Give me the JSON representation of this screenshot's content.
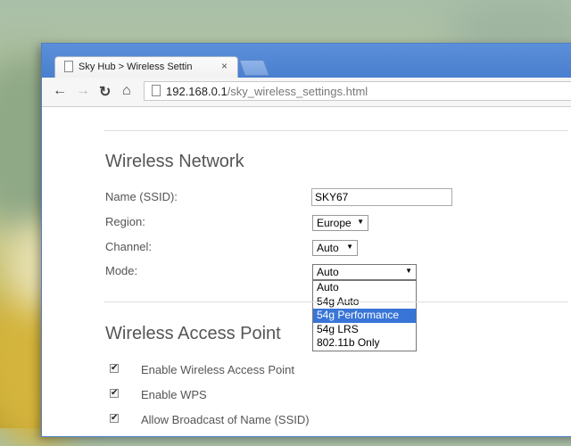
{
  "browser": {
    "tab_title": "Sky Hub > Wireless Settin",
    "tab_close": "×",
    "url_host": "192.168.0.1",
    "url_path": "/sky_wireless_settings.html"
  },
  "wireless_network": {
    "heading": "Wireless Network",
    "name_label": "Name (SSID):",
    "name_value": "SKY67",
    "region_label": "Region:",
    "region_value": "Europe",
    "channel_label": "Channel:",
    "channel_value": "Auto",
    "mode_label": "Mode:",
    "mode_value": "Auto",
    "mode_options": [
      "Auto",
      "54g Auto",
      "54g Performance",
      "54g LRS",
      "802.11b Only"
    ],
    "mode_highlighted": "54g Performance"
  },
  "wireless_access_point": {
    "heading": "Wireless Access Point",
    "checkboxes": [
      {
        "label": "Enable Wireless Access Point",
        "checked": true
      },
      {
        "label": "Enable WPS",
        "checked": true
      },
      {
        "label": "Allow Broadcast of Name (SSID)",
        "checked": true
      }
    ]
  },
  "icons": {
    "back": "back-arrow-icon",
    "forward": "forward-arrow-icon",
    "reload": "reload-icon",
    "home": "home-icon",
    "page": "page-icon"
  },
  "colors": {
    "tabbar": "#4a7fcf",
    "highlight": "#3875d7"
  }
}
